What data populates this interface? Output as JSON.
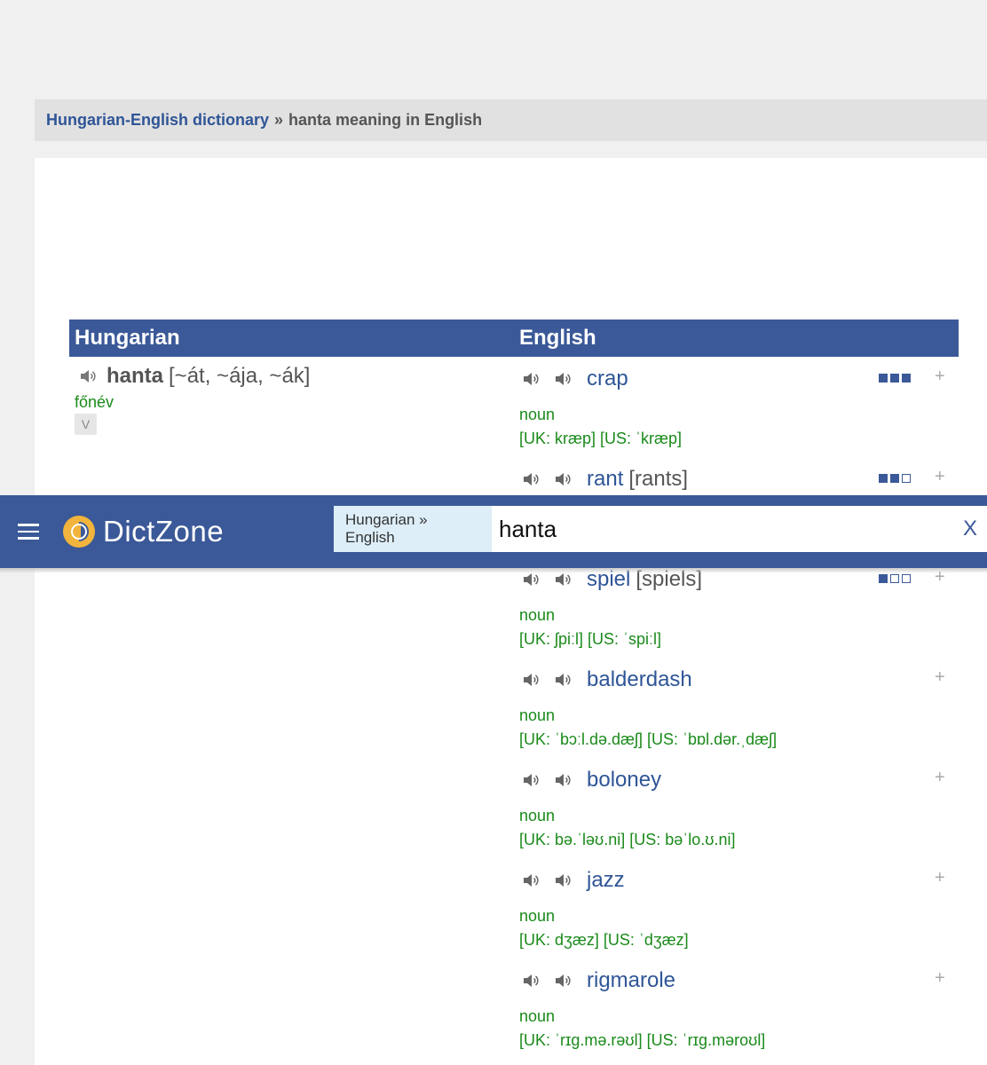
{
  "breadcrumb": {
    "link": "Hungarian-English dictionary",
    "separator": "»",
    "current": "hanta meaning in English"
  },
  "table": {
    "col_hungarian": "Hungarian",
    "col_english": "English"
  },
  "hungarian_entry": {
    "word": "hanta",
    "forms": "[~át, ~ája, ~ák]",
    "pos": "főnév",
    "button_label": "V"
  },
  "english_entries": [
    {
      "word": "crap",
      "extra": "",
      "pos": "noun",
      "pron": "[UK: kræp] [US: ˈkræp]",
      "rating": 3
    },
    {
      "word": "rant",
      "extra": "[rants]",
      "pos": "",
      "pron": "",
      "rating": 2
    },
    {
      "word": "spiel",
      "extra": "[spiels]",
      "pos": "noun",
      "pron": "[UK: ʃpiːl] [US: ˈspiːl]",
      "rating": 1
    },
    {
      "word": "balderdash",
      "extra": "",
      "pos": "noun",
      "pron": "[UK: ˈbɔːl.də.dæʃ] [US: ˈbɒl.dər.ˌdæʃ]",
      "rating": 0
    },
    {
      "word": "boloney",
      "extra": "",
      "pos": "noun",
      "pron": "[UK: bə.ˈləʊ.ni] [US: bəˈlo.ʊ.ni]",
      "rating": 0
    },
    {
      "word": "jazz",
      "extra": "",
      "pos": "noun",
      "pron": "[UK: dʒæz] [US: ˈdʒæz]",
      "rating": 0
    },
    {
      "word": "rigmarole",
      "extra": "",
      "pos": "noun",
      "pron": "[UK: ˈrɪg.mə.rəʊl] [US: ˈrɪg.məroʊl]",
      "rating": 0
    }
  ],
  "plus_symbol": "+",
  "navbar": {
    "brand": "DictZone",
    "lang_pair": "Hungarian » English",
    "search_value": "hanta",
    "clear_label": "X"
  },
  "colors": {
    "primary": "#3b5998",
    "link": "#2f5597",
    "green": "#1a8a1a",
    "logo": "#f2b43c"
  }
}
